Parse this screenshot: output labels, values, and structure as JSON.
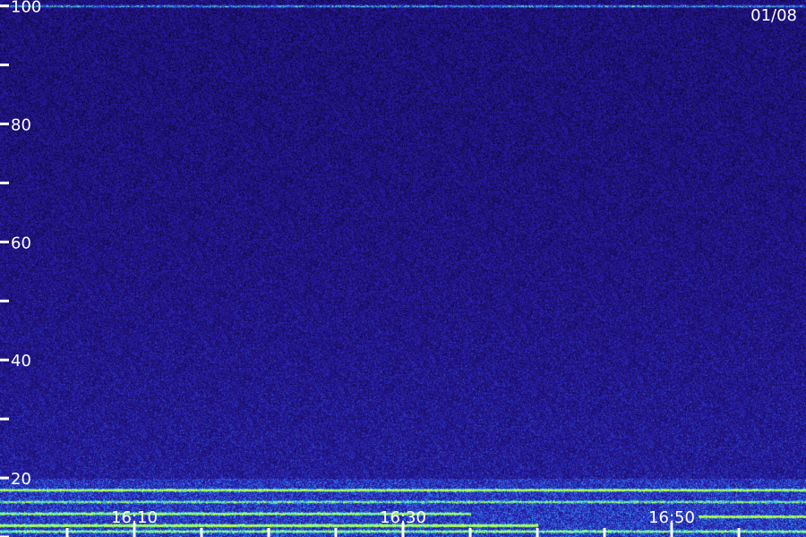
{
  "chart_data": {
    "type": "heatmap",
    "date_label": "01/08",
    "y_ticks": [
      {
        "value": 10,
        "label": ""
      },
      {
        "value": 20,
        "label": "20"
      },
      {
        "value": 30,
        "label": ""
      },
      {
        "value": 40,
        "label": "40"
      },
      {
        "value": 50,
        "label": ""
      },
      {
        "value": 60,
        "label": "60"
      },
      {
        "value": 70,
        "label": ""
      },
      {
        "value": 80,
        "label": "80"
      },
      {
        "value": 90,
        "label": ""
      },
      {
        "value": 100,
        "label": "100"
      }
    ],
    "x_ticks": [
      {
        "value": "16:05",
        "label": ""
      },
      {
        "value": "16:10",
        "label": "16:10"
      },
      {
        "value": "16:15",
        "label": ""
      },
      {
        "value": "16:20",
        "label": ""
      },
      {
        "value": "16:25",
        "label": ""
      },
      {
        "value": "16:30",
        "label": "16:30"
      },
      {
        "value": "16:35",
        "label": ""
      },
      {
        "value": "16:40",
        "label": ""
      },
      {
        "value": "16:45",
        "label": ""
      },
      {
        "value": "16:50",
        "label": "16:50"
      },
      {
        "value": "16:55",
        "label": ""
      }
    ],
    "ylim": [
      10,
      101
    ],
    "xlim": [
      "16:00",
      "17:00"
    ],
    "colors": {
      "background": "#1a0f6a",
      "low": "#2a1aa8",
      "mid": "#2f6cf0",
      "high": "#3ff0d8",
      "peak": "#b8ff40",
      "text": "#ffffff"
    },
    "bands": [
      {
        "y": 100,
        "strength": 0.55,
        "start": "16:00",
        "end": "17:00"
      },
      {
        "y": 18,
        "strength": 0.75,
        "start": "16:00",
        "end": "17:00"
      },
      {
        "y": 16,
        "strength": 0.5,
        "start": "16:00",
        "end": "17:00"
      },
      {
        "y": 14,
        "strength": 0.7,
        "start": "16:00",
        "end": "16:35"
      },
      {
        "y": 13.5,
        "strength": 0.8,
        "start": "16:52",
        "end": "17:00"
      },
      {
        "y": 12,
        "strength": 0.95,
        "start": "16:00",
        "end": "16:40"
      },
      {
        "y": 11,
        "strength": 0.6,
        "start": "16:00",
        "end": "17:00"
      }
    ]
  }
}
